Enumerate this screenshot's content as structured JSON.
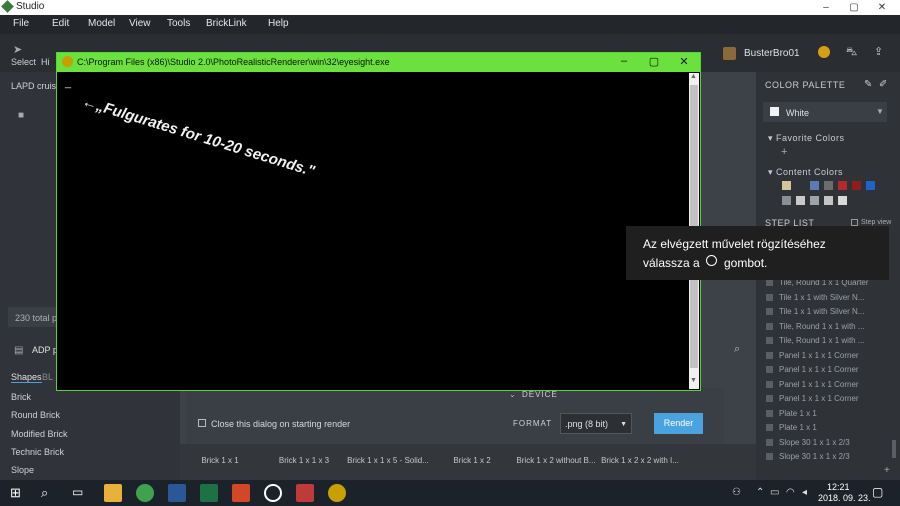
{
  "window": {
    "title": "Studio",
    "min": "–",
    "max": "▢",
    "close": "✕"
  },
  "menu": [
    "File",
    "Edit",
    "Model",
    "View",
    "Tools",
    "BrickLink",
    "Help"
  ],
  "toolbar": {
    "select": "Select",
    "hide": "Hi",
    "user": "BusterBro01"
  },
  "left_panel": {
    "tab": "LAPD cruise",
    "total": "230 total p",
    "palette_name": "ADP p",
    "shapes_tab": "Shapes",
    "shapes_tab2": "BL",
    "categories": [
      "Brick",
      "Round Brick",
      "Modified Brick",
      "Technic Brick",
      "Slope"
    ]
  },
  "right_panel": {
    "color_palette": "COLOR PALETTE",
    "selected_color": "White",
    "favorite_colors": "Favorite Colors",
    "content_colors": "Content Colors",
    "step_list": "STEP LIST",
    "step_view": "Step view",
    "content_swatches": [
      "#d6c49a",
      "#2f3338",
      "#5c7bb3",
      "#6c6c6c",
      "#b22a2a",
      "#8e1d1d",
      "#1e64c8",
      "#8a8f95",
      "#c9c9c9",
      "#9ea3a8",
      "#c4c4c4",
      "#d9d9d9"
    ],
    "steps": [
      "Tile, Round 1 x 1 Quarter",
      "Tile 1 x 1 with Silver N...",
      "Tile 1 x 1 with Silver N...",
      "Tile, Round 1 x 1 with ...",
      "Tile, Round 1 x 1 with ...",
      "Panel 1 x 1 x 1 Corner",
      "Panel 1 x 1 x 1 Corner",
      "Panel 1 x 1 x 1 Corner",
      "Panel 1 x 1 x 1 Corner",
      "Plate 1 x 1",
      "Plate 1 x 1",
      "Slope 30 1 x 1 x 2/3",
      "Slope 30 1 x 1 x 2/3"
    ]
  },
  "console": {
    "path": "C:\\Program Files (x86)\\Studio 2.0\\PhotoRealisticRenderer\\win\\32\\eyesight.exe",
    "cursor": "_",
    "annotation": "←„Fulgurates for 10-20 seconds.\""
  },
  "render_dialog": {
    "device_label": "DEVICE",
    "close_checkbox": "Close this dialog on starting render",
    "format_label": "FORMAT",
    "format_value": ".png (8 bit)",
    "render_button": "Render"
  },
  "parts": [
    "Brick 1 x 1",
    "Brick 1 x 1 x 3",
    "Brick 1 x 1 x 5 - Solid...",
    "Brick 1 x 2",
    "Brick 1 x 2 without B...",
    "Brick 1 x 2 x 2 with I..."
  ],
  "toast": {
    "line1": "Az elvégzett művelet rögzítéséhez",
    "line2_a": "válassza a",
    "line2_b": "gombot."
  },
  "taskbar": {
    "time": "12:21",
    "date": "2018. 09. 23."
  },
  "colors": {
    "console_title": "#6ae13d",
    "render_button": "#4aa3df"
  }
}
